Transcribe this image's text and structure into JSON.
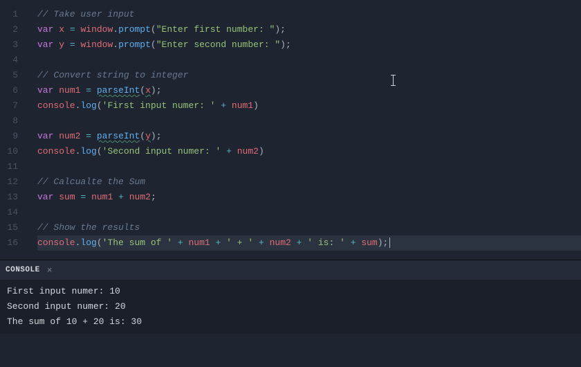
{
  "editor": {
    "line_count": 16,
    "active_line": 16,
    "lines": [
      {
        "n": 1,
        "t": [
          [
            "c",
            "// Take user input"
          ]
        ]
      },
      {
        "n": 2,
        "t": [
          [
            "k",
            "var"
          ],
          [
            "p",
            " "
          ],
          [
            "v",
            "x"
          ],
          [
            "p",
            " "
          ],
          [
            "o",
            "="
          ],
          [
            "p",
            " "
          ],
          [
            "v",
            "window"
          ],
          [
            "pu",
            "."
          ],
          [
            "f",
            "prompt"
          ],
          [
            "pu",
            "("
          ],
          [
            "s",
            "\"Enter first number: \""
          ],
          [
            "pu",
            ");"
          ]
        ]
      },
      {
        "n": 3,
        "t": [
          [
            "k",
            "var"
          ],
          [
            "p",
            " "
          ],
          [
            "v",
            "y"
          ],
          [
            "p",
            " "
          ],
          [
            "o",
            "="
          ],
          [
            "p",
            " "
          ],
          [
            "v",
            "window"
          ],
          [
            "pu",
            "."
          ],
          [
            "f",
            "prompt"
          ],
          [
            "pu",
            "("
          ],
          [
            "s",
            "\"Enter second number: \""
          ],
          [
            "pu",
            ");"
          ]
        ]
      },
      {
        "n": 4,
        "t": []
      },
      {
        "n": 5,
        "t": [
          [
            "c",
            "// Convert string to integer"
          ]
        ]
      },
      {
        "n": 6,
        "t": [
          [
            "k",
            "var"
          ],
          [
            "p",
            " "
          ],
          [
            "v",
            "num1"
          ],
          [
            "p",
            " "
          ],
          [
            "o",
            "="
          ],
          [
            "p",
            " "
          ],
          [
            "fw",
            "parseInt"
          ],
          [
            "pu",
            "("
          ],
          [
            "vw",
            "x"
          ],
          [
            "pu",
            ");"
          ]
        ]
      },
      {
        "n": 7,
        "t": [
          [
            "v",
            "console"
          ],
          [
            "pu",
            "."
          ],
          [
            "f",
            "log"
          ],
          [
            "pu",
            "("
          ],
          [
            "s",
            "'First input numer: '"
          ],
          [
            "p",
            " "
          ],
          [
            "o",
            "+"
          ],
          [
            "p",
            " "
          ],
          [
            "v",
            "num1"
          ],
          [
            "pu",
            ")"
          ]
        ]
      },
      {
        "n": 8,
        "t": []
      },
      {
        "n": 9,
        "t": [
          [
            "k",
            "var"
          ],
          [
            "p",
            " "
          ],
          [
            "v",
            "num2"
          ],
          [
            "p",
            " "
          ],
          [
            "o",
            "="
          ],
          [
            "p",
            " "
          ],
          [
            "fw",
            "parseInt"
          ],
          [
            "pu",
            "("
          ],
          [
            "vw",
            "y"
          ],
          [
            "pu",
            ");"
          ]
        ]
      },
      {
        "n": 10,
        "t": [
          [
            "v",
            "console"
          ],
          [
            "pu",
            "."
          ],
          [
            "f",
            "log"
          ],
          [
            "pu",
            "("
          ],
          [
            "s",
            "'Second input numer: '"
          ],
          [
            "p",
            " "
          ],
          [
            "o",
            "+"
          ],
          [
            "p",
            " "
          ],
          [
            "v",
            "num2"
          ],
          [
            "pu",
            ")"
          ]
        ]
      },
      {
        "n": 11,
        "t": []
      },
      {
        "n": 12,
        "t": [
          [
            "c",
            "// Calcualte the Sum"
          ]
        ]
      },
      {
        "n": 13,
        "t": [
          [
            "k",
            "var"
          ],
          [
            "p",
            " "
          ],
          [
            "v",
            "sum"
          ],
          [
            "p",
            " "
          ],
          [
            "o",
            "="
          ],
          [
            "p",
            " "
          ],
          [
            "v",
            "num1"
          ],
          [
            "p",
            " "
          ],
          [
            "o",
            "+"
          ],
          [
            "p",
            " "
          ],
          [
            "v",
            "num2"
          ],
          [
            "pu",
            ";"
          ]
        ]
      },
      {
        "n": 14,
        "t": []
      },
      {
        "n": 15,
        "t": [
          [
            "c",
            "// Show the results"
          ]
        ]
      },
      {
        "n": 16,
        "t": [
          [
            "v",
            "console"
          ],
          [
            "pu",
            "."
          ],
          [
            "f",
            "log"
          ],
          [
            "pu",
            "("
          ],
          [
            "s",
            "'The sum of '"
          ],
          [
            "p",
            " "
          ],
          [
            "o",
            "+"
          ],
          [
            "p",
            " "
          ],
          [
            "v",
            "num1"
          ],
          [
            "p",
            " "
          ],
          [
            "o",
            "+"
          ],
          [
            "p",
            " "
          ],
          [
            "s",
            "' + '"
          ],
          [
            "p",
            " "
          ],
          [
            "o",
            "+"
          ],
          [
            "p",
            " "
          ],
          [
            "v",
            "num2"
          ],
          [
            "p",
            " "
          ],
          [
            "o",
            "+"
          ],
          [
            "p",
            " "
          ],
          [
            "s",
            "' is: '"
          ],
          [
            "p",
            " "
          ],
          [
            "o",
            "+"
          ],
          [
            "p",
            " "
          ],
          [
            "v",
            "sum"
          ],
          [
            "pu",
            ");"
          ]
        ],
        "cursor": true
      }
    ]
  },
  "panel": {
    "tab": "CONSOLE",
    "output": [
      "First input numer: 10",
      "Second input numer: 20",
      "The sum of 10 + 20 is: 30"
    ]
  },
  "colors": {
    "c": "#6a7a8f",
    "k": "#c678dd",
    "v": "#e06c75",
    "f": "#61afef",
    "fw": "#61afef",
    "vw": "#e06c75",
    "s": "#98c379",
    "o": "#56b6c2",
    "pu": "#abb2bf",
    "p": "#abb2bf"
  },
  "styles": {
    "c": "italic"
  },
  "warn": [
    "fw",
    "vw"
  ]
}
